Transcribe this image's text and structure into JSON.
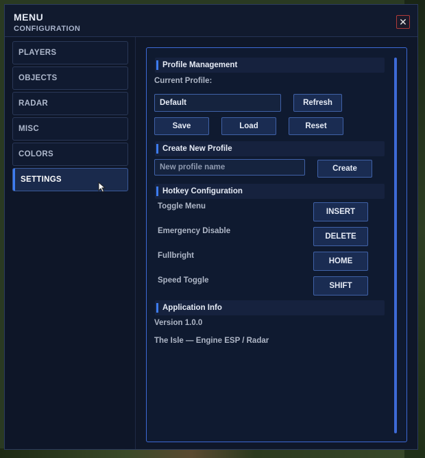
{
  "window": {
    "title": "MENU",
    "subtitle": "CONFIGURATION",
    "close_label": "✕"
  },
  "sidebar": {
    "items": [
      {
        "label": "PLAYERS",
        "active": false
      },
      {
        "label": "OBJECTS",
        "active": false
      },
      {
        "label": "RADAR",
        "active": false
      },
      {
        "label": "MISC",
        "active": false
      },
      {
        "label": "COLORS",
        "active": false
      },
      {
        "label": "SETTINGS",
        "active": true
      }
    ]
  },
  "profile": {
    "header": "Profile Management",
    "current_label": "Current Profile:",
    "current_value": "Default",
    "refresh_label": "Refresh",
    "save_label": "Save",
    "load_label": "Load",
    "reset_label": "Reset"
  },
  "create": {
    "header": "Create New Profile",
    "placeholder": "New profile name",
    "create_label": "Create"
  },
  "hotkeys": {
    "header": "Hotkey Configuration",
    "rows": [
      {
        "label": "Toggle Menu",
        "key": "INSERT"
      },
      {
        "label": "Emergency Disable",
        "key": "DELETE"
      },
      {
        "label": "Fullbright",
        "key": "HOME"
      },
      {
        "label": "Speed Toggle",
        "key": "SHIFT"
      }
    ]
  },
  "info": {
    "header": "Application Info",
    "version": "Version 1.0.0",
    "description": "The Isle — Engine ESP / Radar"
  },
  "colors": {
    "accent": "#3d7cf0",
    "close_border": "#b03a3a",
    "window_bg": "#0f1729"
  },
  "icons": [
    "close-icon",
    "cursor-icon"
  ]
}
